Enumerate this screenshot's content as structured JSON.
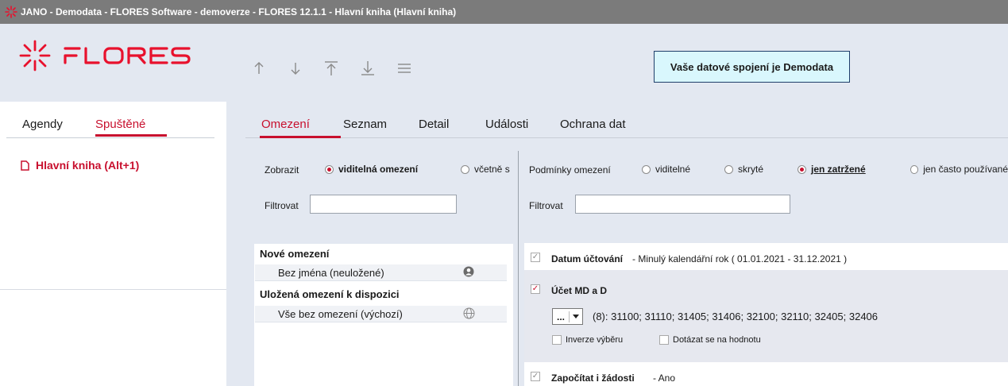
{
  "titlebar": {
    "title": "JANO - Demodata - FLORES Software - demoverze - FLORES 12.1.1 - Hlavní kniha  (Hlavní kniha)"
  },
  "brand": {
    "logo_text": "FLORES",
    "accent": "#c8102e"
  },
  "toolbar": {
    "icons": [
      "arrow-up-icon",
      "arrow-down-icon",
      "arrow-top-icon",
      "arrow-bottom-icon",
      "menu-icon"
    ]
  },
  "connection": {
    "label": "Vaše datové spojení je Demodata"
  },
  "left": {
    "tabs": [
      {
        "label": "Agendy"
      },
      {
        "label": "Spuštěné"
      }
    ],
    "running": [
      {
        "label": "Hlavní kniha (Alt+1)"
      }
    ]
  },
  "main": {
    "tabs": [
      {
        "label": "Omezení"
      },
      {
        "label": "Seznam"
      },
      {
        "label": "Detail"
      },
      {
        "label": "Události"
      },
      {
        "label": "Ochrana dat"
      }
    ]
  },
  "limits": {
    "show_label": "Zobrazit",
    "show_options": [
      {
        "label": "viditelná omezení",
        "selected": true
      },
      {
        "label": "včetně s",
        "selected": false
      }
    ],
    "filter_label": "Filtrovat",
    "filter_value": "",
    "new_header": "Nové omezení",
    "new_items": [
      {
        "label": "Bez jména (neuložené)",
        "icon": "user-icon"
      }
    ],
    "saved_header": "Uložená omezení k dispozici",
    "saved_items": [
      {
        "label": "Vše bez omezení (výchozí)",
        "icon": "globe-icon"
      }
    ]
  },
  "conditions": {
    "label": "Podmínky omezení",
    "options": [
      {
        "label": "viditelné",
        "selected": false
      },
      {
        "label": "skryté",
        "selected": false
      },
      {
        "label": "jen zatržené",
        "selected": true
      },
      {
        "label": "jen často používané",
        "selected": false
      }
    ],
    "filter_label": "Filtrovat",
    "filter_value": "",
    "rows": [
      {
        "name": "Datum účtování",
        "detail": "- Minulý kalendářní rok ( 01.01.2021 - 31.12.2021 )",
        "checked": true
      },
      {
        "name": "Účet MD a D",
        "checked": true,
        "dropdown_value": "...",
        "values": "(8): 31100; 31110; 31405; 31406; 32100; 32110; 32405; 32406",
        "option1": "Inverze výběru",
        "option2": "Dotázat se na hodnotu"
      },
      {
        "name": "Započítat i žádosti",
        "detail": "- Ano",
        "checked": true
      }
    ]
  }
}
